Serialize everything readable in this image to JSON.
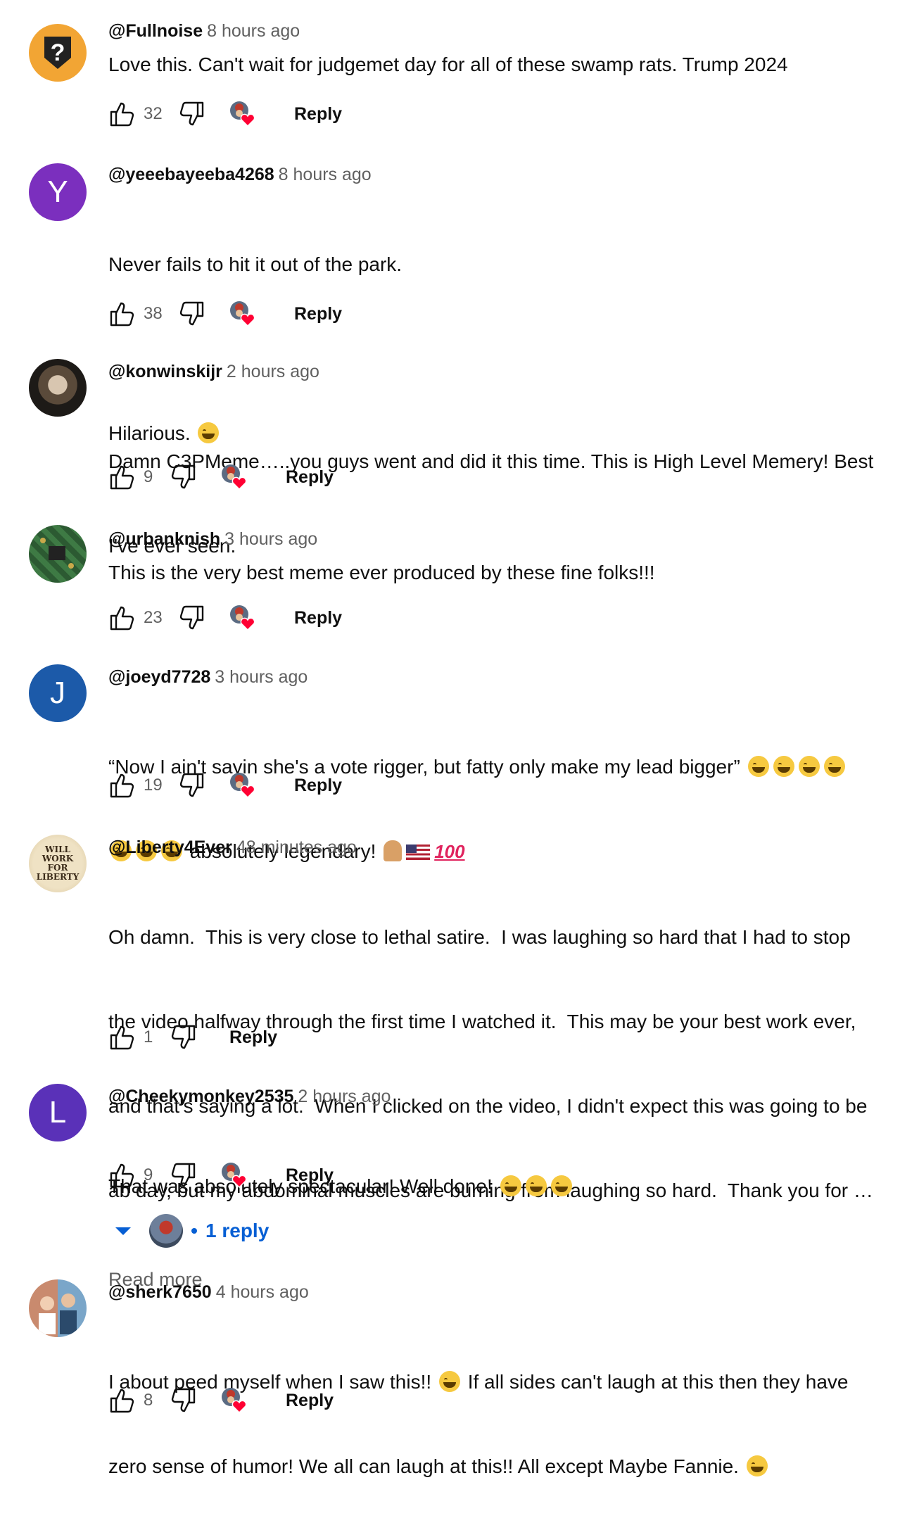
{
  "comments": [
    {
      "author": "@Fullnoise",
      "time": "8 hours ago",
      "text_lines": [
        "Love this. Can't wait for judgemet day for all of these swamp rats. Trump 2024"
      ],
      "likes": "32",
      "reply": "Reply"
    },
    {
      "author": "@yeeebayeeba4268",
      "time": "8 hours ago",
      "avatar_letter": "Y",
      "text_lines": [
        "Never fails to hit it out of the park.",
        "",
        "Hilarious."
      ],
      "likes": "38",
      "reply": "Reply"
    },
    {
      "author": "@konwinskijr",
      "time": "2 hours ago",
      "text_lines": [
        "Damn C3PMeme…..you guys went and did it this time. This is High Level Memery! Best",
        "I've ever seen."
      ],
      "likes": "9",
      "reply": "Reply"
    },
    {
      "author": "@urbanknish",
      "time": "3 hours ago",
      "text_lines": [
        "This is the very best meme ever produced by these fine folks!!!"
      ],
      "likes": "23",
      "reply": "Reply"
    },
    {
      "author": "@joeyd7728",
      "time": "3 hours ago",
      "avatar_letter": "J",
      "text_line1": "“Now I ain't sayin she's a vote rigger, but fatty only make my lead bigger”",
      "text_line2": "absolutely legendary!",
      "hundred": "100",
      "likes": "19",
      "reply": "Reply"
    },
    {
      "author": "@Liberty4Ever",
      "time": "48 minutes ago",
      "avatar_text": [
        "WILL",
        "WORK",
        "FOR",
        "LIBERTY"
      ],
      "text_lines": [
        "Oh damn.  This is very close to lethal satire.  I was laughing so hard that I had to stop",
        "the video halfway through the first time I watched it.  This may be your best work ever,",
        "and that's saying a lot.  When I clicked on the video, I didn't expect this was going to be",
        "ab day, but my abdominal muscles are burning from laughing so hard.  Thank you for …"
      ],
      "read_more": "Read more",
      "likes": "1",
      "reply": "Reply"
    },
    {
      "author": "@Cheekymonkey2535",
      "time": "2 hours ago",
      "avatar_letter": "L",
      "text_line1": "That was absolutely spectacular! Well done!",
      "likes": "9",
      "reply": "Reply",
      "replies_label": "1 reply"
    },
    {
      "author": "@sherk7650",
      "time": "4 hours ago",
      "text_line1": "I about peed myself when I saw this!!",
      "text_line1b": "If all sides can't laugh at this then they have",
      "text_line2": "zero sense of humor! We all can laugh at this!! All except Maybe Fannie.",
      "likes": "8",
      "reply": "Reply"
    }
  ],
  "colors": {
    "accent": "#065fd4",
    "text": "#0f0f0f",
    "secondary": "#606060",
    "avatar_y": "#7b2fbe",
    "avatar_j": "#1c5aa9",
    "avatar_l": "#5a31b8",
    "avatar_fullnoise": "#f2a534"
  },
  "icons": [
    "like-icon",
    "dislike-icon",
    "creator-heart-icon",
    "caret-down-icon"
  ]
}
